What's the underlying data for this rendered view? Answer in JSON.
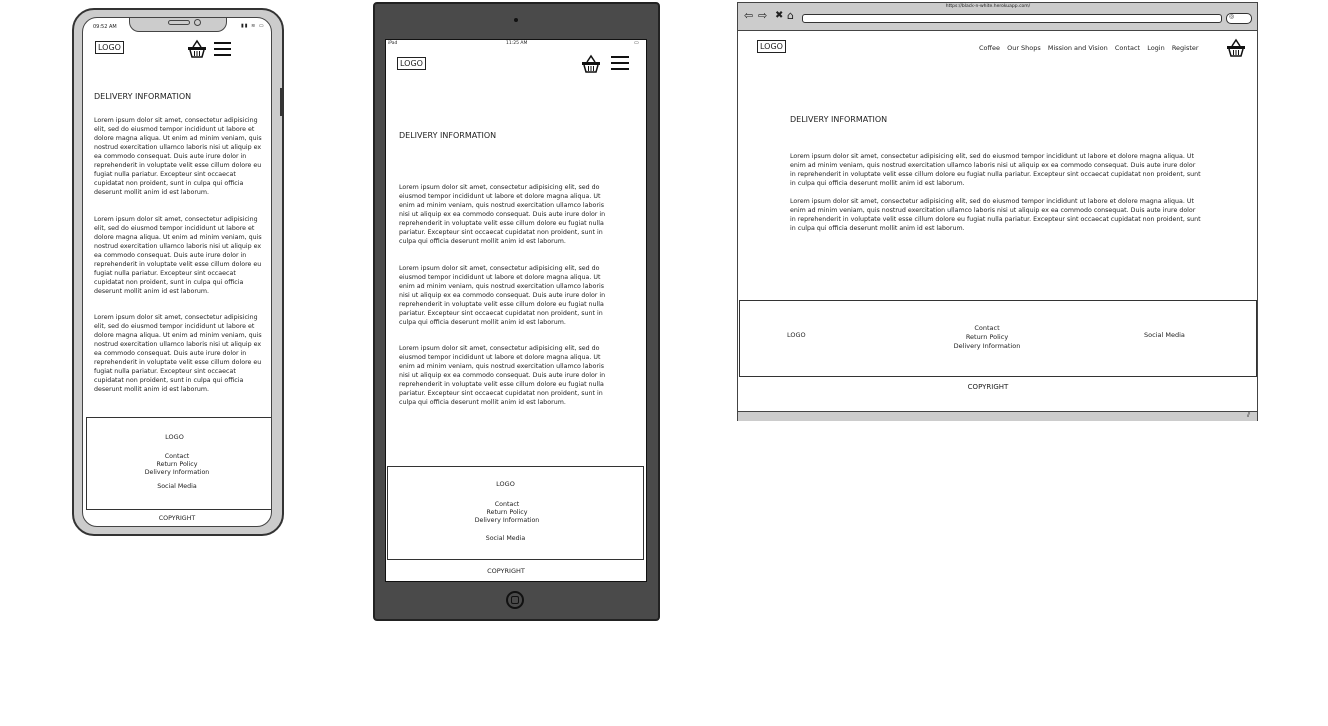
{
  "phone": {
    "status_time": "09:52 AM",
    "logo": "LOGO",
    "heading": "DELIVERY INFORMATION",
    "paragraphs": [
      "Lorem ipsum dolor sit amet, consectetur adipisicing elit, sed do eiusmod tempor incididunt ut labore et dolore magna aliqua. Ut enim ad minim veniam, quis nostrud exercitation ullamco laboris nisi ut aliquip ex ea commodo consequat. Duis aute irure dolor in reprehenderit in voluptate velit esse cillum dolore eu fugiat nulla pariatur. Excepteur sint occaecat cupidatat non proident, sunt in culpa qui officia deserunt mollit anim id est laborum.",
      "Lorem ipsum dolor sit amet, consectetur adipisicing elit, sed do eiusmod tempor incididunt ut labore et dolore magna aliqua. Ut enim ad minim veniam, quis nostrud exercitation ullamco laboris nisi ut aliquip ex ea commodo consequat. Duis aute irure dolor in reprehenderit in voluptate velit esse cillum dolore eu fugiat nulla pariatur. Excepteur sint occaecat cupidatat non proident, sunt in culpa qui officia deserunt mollit anim id est laborum.",
      "Lorem ipsum dolor sit amet, consectetur adipisicing elit, sed do eiusmod tempor incididunt ut labore et dolore magna aliqua. Ut enim ad minim veniam, quis nostrud exercitation ullamco laboris nisi ut aliquip ex ea commodo consequat. Duis aute irure dolor in reprehenderit in voluptate velit esse cillum dolore eu fugiat nulla pariatur. Excepteur sint occaecat cupidatat non proident, sunt in culpa qui officia deserunt mollit anim id est laborum."
    ],
    "footer": {
      "logo": "LOGO",
      "links": [
        "Contact",
        "Return Policy",
        "Delivery Information"
      ],
      "social": "Social Media",
      "copyright": "COPYRIGHT"
    }
  },
  "tablet": {
    "status_left": "iPad",
    "status_time": "11:25 AM",
    "logo": "LOGO",
    "heading": "DELIVERY INFORMATION",
    "paragraphs": [
      "Lorem ipsum dolor sit amet, consectetur adipisicing elit, sed do eiusmod tempor incididunt ut labore et dolore magna aliqua. Ut enim ad minim veniam, quis nostrud exercitation ullamco laboris nisi ut aliquip ex ea commodo consequat. Duis aute irure dolor in reprehenderit in voluptate velit esse cillum dolore eu fugiat nulla pariatur. Excepteur sint occaecat cupidatat non proident, sunt in culpa qui officia deserunt mollit anim id est laborum.",
      "Lorem ipsum dolor sit amet, consectetur adipisicing elit, sed do eiusmod tempor incididunt ut labore et dolore magna aliqua. Ut enim ad minim veniam, quis nostrud exercitation ullamco laboris nisi ut aliquip ex ea commodo consequat. Duis aute irure dolor in reprehenderit in voluptate velit esse cillum dolore eu fugiat nulla pariatur. Excepteur sint occaecat cupidatat non proident, sunt in culpa qui officia deserunt mollit anim id est laborum.",
      "Lorem ipsum dolor sit amet, consectetur adipisicing elit, sed do eiusmod tempor incididunt ut labore et dolore magna aliqua. Ut enim ad minim veniam, quis nostrud exercitation ullamco laboris nisi ut aliquip ex ea commodo consequat. Duis aute irure dolor in reprehenderit in voluptate velit esse cillum dolore eu fugiat nulla pariatur. Excepteur sint occaecat cupidatat non proident, sunt in culpa qui officia deserunt mollit anim id est laborum."
    ],
    "footer": {
      "logo": "LOGO",
      "links": [
        "Contact",
        "Return Policy",
        "Delivery Information"
      ],
      "social": "Social Media",
      "copyright": "COPYRIGHT"
    }
  },
  "browser": {
    "url": "https://black-n-white.herokuapp.com/",
    "logo": "LOGO",
    "nav": [
      "Coffee",
      "Our Shops",
      "Mission and Vision",
      "Contact",
      "Login",
      "Register"
    ],
    "heading": "DELIVERY INFORMATION",
    "paragraphs": [
      "Lorem ipsum dolor sit amet, consectetur adipisicing elit, sed do eiusmod tempor incididunt ut labore et dolore magna aliqua. Ut enim ad minim veniam, quis nostrud exercitation ullamco laboris nisi ut aliquip ex ea commodo consequat. Duis aute irure dolor in reprehenderit in voluptate velit esse cillum dolore eu fugiat nulla pariatur. Excepteur sint occaecat cupidatat non proident, sunt in culpa qui officia deserunt mollit anim id est laborum.",
      "Lorem ipsum dolor sit amet, consectetur adipisicing elit, sed do eiusmod tempor incididunt ut labore et dolore magna aliqua. Ut enim ad minim veniam, quis nostrud exercitation ullamco laboris nisi ut aliquip ex ea commodo consequat. Duis aute irure dolor in reprehenderit in voluptate velit esse cillum dolore eu fugiat nulla pariatur. Excepteur sint occaecat cupidatat non proident, sunt in culpa qui officia deserunt mollit anim id est laborum."
    ],
    "footer": {
      "logo": "LOGO",
      "links": [
        "Contact",
        "Return Policy",
        "Delivery Information"
      ],
      "social": "Social Media",
      "copyright": "COPYRIGHT"
    }
  }
}
